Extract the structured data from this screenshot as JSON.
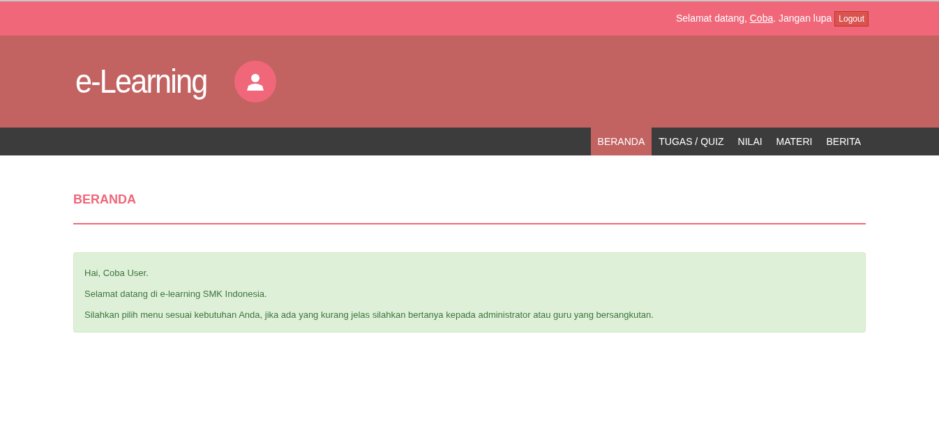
{
  "top_bar": {
    "greeting_before": "Selamat datang, ",
    "user_link": "Coba",
    "greeting_after": ". Jangan lupa",
    "logout_button": "Logout"
  },
  "header": {
    "site_title": "e-Learning"
  },
  "nav": [
    {
      "label": "BERANDA",
      "selected": true
    },
    {
      "label": "TUGAS / QUIZ",
      "selected": false
    },
    {
      "label": "NILAI",
      "selected": false
    },
    {
      "label": "MATERI",
      "selected": false
    },
    {
      "label": "BERITA",
      "selected": false
    }
  ],
  "page_title": "BERANDA",
  "alert": {
    "paragraphs": [
      "Hai, Coba User.",
      "Selamat datang di e-learning SMK Indonesia.",
      "Silahkan pilih menu sesuai kebutuhan Anda, jika ada yang kurang jelas silahkan bertanya kepada administrator atau guru yang bersangkutan."
    ]
  }
}
